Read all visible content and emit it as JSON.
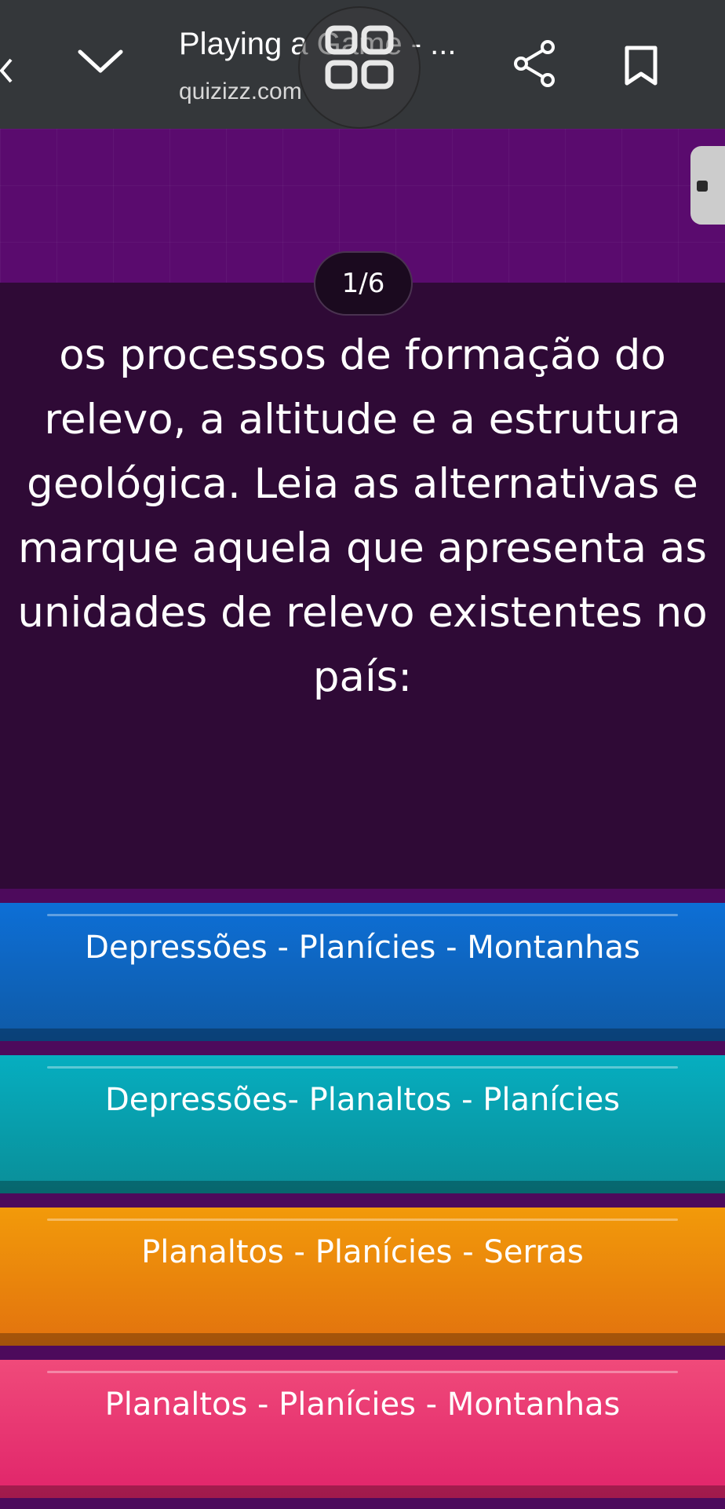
{
  "browser": {
    "title": "Playing a Game - ...",
    "url": "quizizz.com",
    "icons": [
      "back-icon",
      "chevron-down-icon",
      "tabs-overview-icon",
      "share-icon",
      "bookmark-icon"
    ]
  },
  "quiz": {
    "counter": "1/6",
    "question": "os processos de formação do relevo, a altitude e a estrutura geológica. Leia as alternativas e marque aquela que apresenta as unidades de relevo existentes no país:",
    "answers": [
      {
        "label": "Depressões - Planícies - Montanhas",
        "color": "#0d6fd6"
      },
      {
        "label": "Depressões- Planaltos - Planícies",
        "color": "#06aec0"
      },
      {
        "label": "Planaltos - Planícies - Serras",
        "color": "#f29a0a"
      },
      {
        "label": "Planaltos - Planícies - Montanhas",
        "color": "#f04a7a"
      }
    ]
  },
  "colors": {
    "browser_bar": "#34373a",
    "header_band": "#5a0b6e",
    "question_bg": "#2f0a36"
  }
}
